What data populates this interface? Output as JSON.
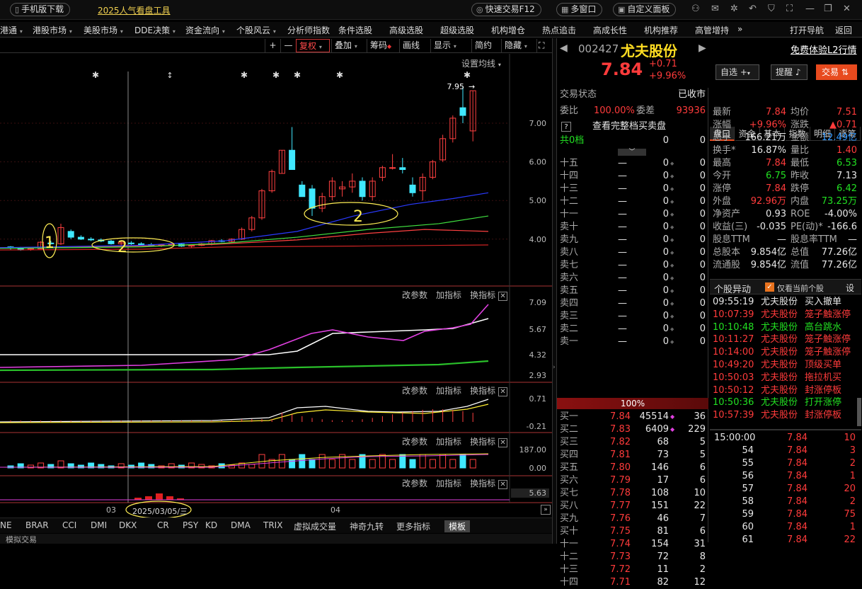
{
  "topbar": {
    "mobile": "手机版下载",
    "promo": "2025人气看盘工具",
    "quick_trade": "快速交易F12",
    "multi_window": "多窗口",
    "custom_panel": "自定义面板"
  },
  "menu": [
    {
      "label": "港通",
      "dd": true
    },
    {
      "label": "港股市场",
      "dd": true
    },
    {
      "label": "美股市场",
      "dd": true
    },
    {
      "label": "DDE决策",
      "dd": true
    },
    {
      "label": "资金流向",
      "dd": true
    },
    {
      "label": "个股风云",
      "dd": true
    },
    {
      "label": "分析师指数",
      "dd": false
    },
    {
      "label": "条件选股",
      "dd": false
    },
    {
      "label": "高级选股",
      "dd": false
    },
    {
      "label": "超级选股",
      "dd": false
    },
    {
      "label": "机构增仓",
      "dd": false
    },
    {
      "label": "热点追击",
      "dd": false
    },
    {
      "label": "高成长性",
      "dd": false
    },
    {
      "label": "机构推荐",
      "dd": false
    },
    {
      "label": "高管增持",
      "dd": false
    },
    {
      "label": "»",
      "dd": false
    },
    {
      "label": "打开导航",
      "dd": false
    },
    {
      "label": "返回",
      "dd": false
    }
  ],
  "toolbar": {
    "plus": "+",
    "minus": "—",
    "fuquan": "复权",
    "diejia": "叠加",
    "chouma": "筹码",
    "huaxian": "画线",
    "xianshi": "显示",
    "jianyue": "简约",
    "yincang": "隐藏"
  },
  "chart": {
    "setting": "设置均线",
    "high_label": "7.95",
    "price_ticks": [
      "7.00",
      "6.00",
      "5.00",
      "4.00"
    ],
    "p2_ticks": [
      "7.09",
      "5.67",
      "4.32",
      "2.93"
    ],
    "p3_ticks": [
      "0.71",
      "-0.21"
    ],
    "p4_ticks": [
      "187.00",
      "0.00"
    ],
    "p5_value": "5.63",
    "panel_actions": [
      "改参数",
      "加指标",
      "换指标"
    ],
    "x_labels": [
      "03",
      "04"
    ],
    "date_cursor": "2025/03/05/三",
    "annotations": [
      "1",
      "2",
      "2"
    ]
  },
  "chart_data": {
    "type": "candlestick",
    "x_labels": [
      "03",
      "04"
    ],
    "ylim": [
      3.5,
      8.0
    ],
    "high": 7.95,
    "cursor_date": "2025/03/05/三"
  },
  "bottom_tabs": [
    "NE",
    "BRAR",
    "CCI",
    "DMI",
    "DKX",
    "CR",
    "PSY",
    "KD",
    "DMA",
    "TRIX",
    "虚拟成交量",
    "神奇九转",
    "更多指标",
    "模板"
  ],
  "stock": {
    "code": "002427",
    "name": "尤夫股份",
    "price": "7.84",
    "change": "+0.71",
    "pct": "+9.96%",
    "free_l2": "免费体验L2行情",
    "btn_watch": "自选",
    "btn_alert": "提醒",
    "btn_trade": "交易"
  },
  "status": {
    "label": "交易状态",
    "value": "已收市"
  },
  "weibi": {
    "label": "委比",
    "value": "100.00%",
    "diff_label": "委差",
    "diff": "93936"
  },
  "full_book": "查看完整档买卖盘",
  "gong": {
    "label": "共0档",
    "v1": "0",
    "v2": "0"
  },
  "sells": [
    "十五",
    "十四",
    "十三",
    "十二",
    "十一",
    "卖十",
    "卖九",
    "卖八",
    "卖七",
    "卖六",
    "卖五",
    "卖四",
    "卖三",
    "卖二",
    "卖一"
  ],
  "sell_price": "—",
  "sell_vol": "0",
  "sell_cnt": "0",
  "bar_pct": "100%",
  "buys": [
    {
      "n": "买一",
      "p": "7.84",
      "v": "45514",
      "c": "36"
    },
    {
      "n": "买二",
      "p": "7.83",
      "v": "6409",
      "c": "229"
    },
    {
      "n": "买三",
      "p": "7.82",
      "v": "68",
      "c": "5"
    },
    {
      "n": "买四",
      "p": "7.81",
      "v": "73",
      "c": "5"
    },
    {
      "n": "买五",
      "p": "7.80",
      "v": "146",
      "c": "6"
    },
    {
      "n": "买六",
      "p": "7.79",
      "v": "17",
      "c": "6"
    },
    {
      "n": "买七",
      "p": "7.78",
      "v": "108",
      "c": "10"
    },
    {
      "n": "买八",
      "p": "7.77",
      "v": "151",
      "c": "22"
    },
    {
      "n": "买九",
      "p": "7.76",
      "v": "46",
      "c": "7"
    },
    {
      "n": "买十",
      "p": "7.75",
      "v": "81",
      "c": "6"
    },
    {
      "n": "十一",
      "p": "7.74",
      "v": "154",
      "c": "31"
    },
    {
      "n": "十二",
      "p": "7.73",
      "v": "72",
      "c": "8"
    },
    {
      "n": "十三",
      "p": "7.72",
      "v": "11",
      "c": "2"
    },
    {
      "n": "十四",
      "p": "7.71",
      "v": "82",
      "c": "12"
    }
  ],
  "tabs": [
    "盘口",
    "资金",
    "基本",
    "指数",
    "明细",
    "逐笔"
  ],
  "quote": [
    [
      "最新",
      "7.84",
      "red",
      "均价",
      "7.51",
      "red"
    ],
    [
      "涨幅",
      "+9.96%",
      "red",
      "涨跌",
      "▲0.71",
      "red"
    ],
    [
      "总手",
      "166.21万",
      "wht",
      "金额",
      "12.49亿",
      "cyn"
    ],
    [
      "换手*",
      "16.87%",
      "wht",
      "量比",
      "1.40",
      "red"
    ],
    [
      "最高",
      "7.84",
      "red",
      "最低",
      "6.53",
      "grn"
    ],
    [
      "今开",
      "6.75",
      "grn",
      "昨收",
      "7.13",
      "wht"
    ],
    [
      "涨停",
      "7.84",
      "red",
      "跌停",
      "6.42",
      "grn"
    ],
    [
      "外盘",
      "92.96万",
      "red",
      "内盘",
      "73.25万",
      "grn"
    ],
    [
      "净资产",
      "0.93",
      "wht",
      "ROE",
      "-4.00%",
      "wht"
    ],
    [
      "收益(三)",
      "-0.035",
      "wht",
      "PE(动)*",
      "-166.6",
      "wht"
    ],
    [
      "股息TTM",
      "—",
      "wht",
      "股息率TTM",
      "—",
      "wht"
    ],
    [
      "总股本",
      "9.854亿",
      "wht",
      "总值",
      "77.26亿",
      "wht"
    ],
    [
      "流通股",
      "9.854亿",
      "wht",
      "流值",
      "77.26亿",
      "wht"
    ]
  ],
  "movement": {
    "title": "个股异动",
    "only_current": "仅看当前个股",
    "settings": "设",
    "rows": [
      [
        "09:55:19",
        "尤夫股份",
        "买入撤单",
        "wht"
      ],
      [
        "10:07:39",
        "尤夫股份",
        "笼子触涨停",
        "red"
      ],
      [
        "10:10:48",
        "尤夫股份",
        "高台跳水",
        "grn"
      ],
      [
        "10:11:27",
        "尤夫股份",
        "笼子触涨停",
        "red"
      ],
      [
        "10:14:00",
        "尤夫股份",
        "笼子触涨停",
        "red"
      ],
      [
        "10:49:20",
        "尤夫股份",
        "顶级买单",
        "red"
      ],
      [
        "10:50:03",
        "尤夫股份",
        "拖拉机买",
        "red"
      ],
      [
        "10:50:12",
        "尤夫股份",
        "封涨停板",
        "red"
      ],
      [
        "10:50:36",
        "尤夫股份",
        "打开涨停",
        "grn"
      ],
      [
        "10:57:39",
        "尤夫股份",
        "封涨停板",
        "red"
      ]
    ]
  },
  "ticks": [
    [
      "15:00:00",
      "7.84",
      "10"
    ],
    [
      "54",
      "7.84",
      "3"
    ],
    [
      "55",
      "7.84",
      "2"
    ],
    [
      "56",
      "7.84",
      "1"
    ],
    [
      "57",
      "7.84",
      "20"
    ],
    [
      "58",
      "7.84",
      "2"
    ],
    [
      "59",
      "7.84",
      "75"
    ],
    [
      "60",
      "7.84",
      "1"
    ],
    [
      "61",
      "7.84",
      "22"
    ]
  ],
  "bottom_left": "模拟交易"
}
